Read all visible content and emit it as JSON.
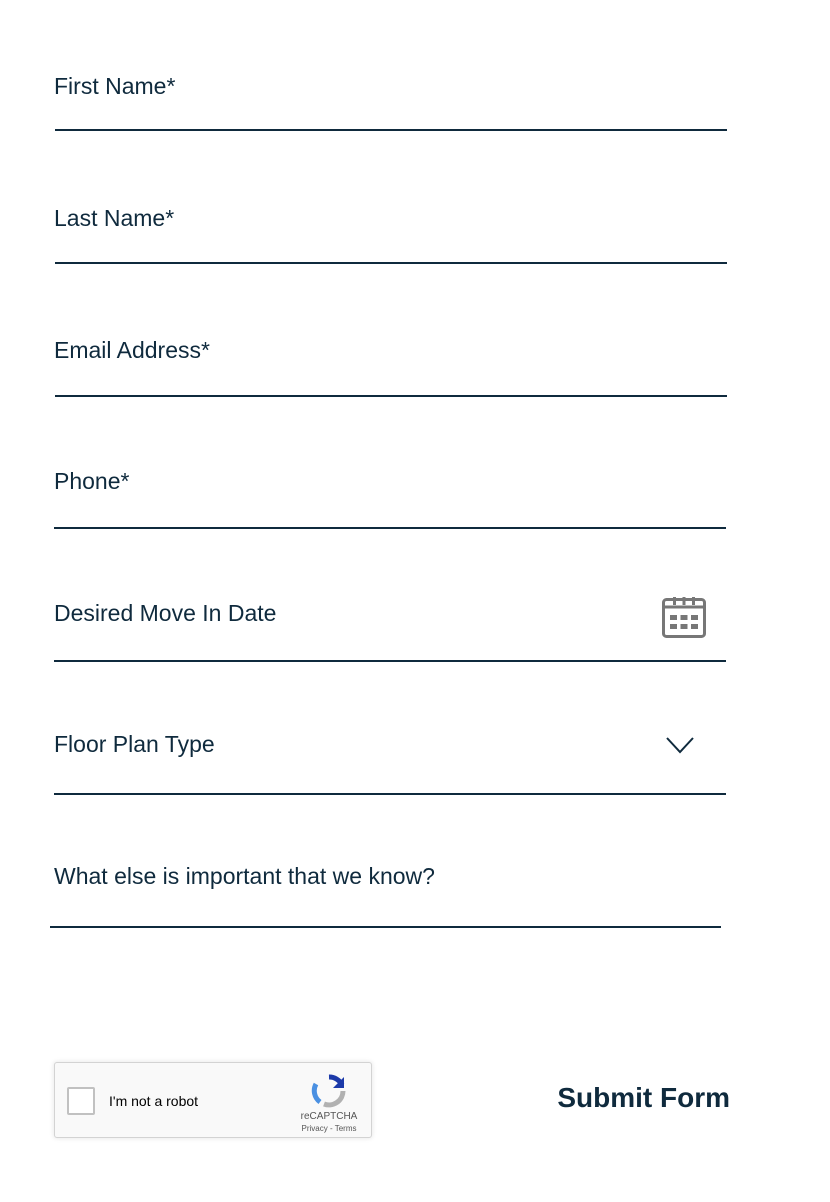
{
  "form": {
    "fields": {
      "first_name": {
        "label": "First Name*",
        "value": ""
      },
      "last_name": {
        "label": "Last Name*",
        "value": ""
      },
      "email": {
        "label": "Email Address*",
        "value": ""
      },
      "phone": {
        "label": "Phone*",
        "value": ""
      },
      "move_in_date": {
        "label": "Desired Move In Date",
        "value": "",
        "icon": "calendar-icon"
      },
      "floor_plan": {
        "label": "Floor Plan Type",
        "selected": "",
        "icon": "chevron-down-icon"
      },
      "notes": {
        "label": "What else is important that we know?",
        "value": ""
      }
    },
    "recaptcha": {
      "label": "I'm not a robot",
      "brand": "reCAPTCHA",
      "links": "Privacy - Terms",
      "checked": false
    },
    "submit_label": "Submit Form"
  },
  "colors": {
    "text": "#0f2a3d",
    "underline": "#0f2a3d",
    "icon_gray": "#777777",
    "recaptcha_blue": "#1c3aa9",
    "recaptcha_lightblue": "#4a90e2",
    "recaptcha_gray": "#b1b1b1"
  }
}
